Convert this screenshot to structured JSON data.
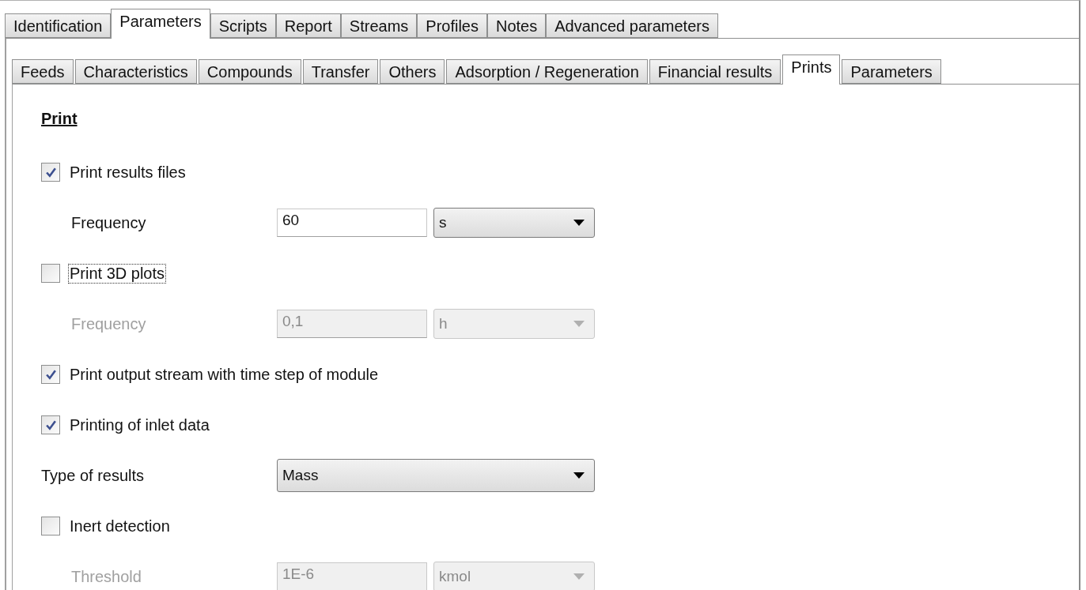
{
  "main_tabs": [
    {
      "label": "Identification",
      "selected": false
    },
    {
      "label": "Parameters",
      "selected": true
    },
    {
      "label": "Scripts",
      "selected": false
    },
    {
      "label": "Report",
      "selected": false
    },
    {
      "label": "Streams",
      "selected": false
    },
    {
      "label": "Profiles",
      "selected": false
    },
    {
      "label": "Notes",
      "selected": false
    },
    {
      "label": "Advanced parameters",
      "selected": false
    }
  ],
  "sub_tabs": [
    {
      "label": "Feeds",
      "selected": false
    },
    {
      "label": "Characteristics",
      "selected": false
    },
    {
      "label": "Compounds",
      "selected": false
    },
    {
      "label": "Transfer",
      "selected": false
    },
    {
      "label": "Others",
      "selected": false
    },
    {
      "label": "Adsorption / Regeneration",
      "selected": false
    },
    {
      "label": "Financial results",
      "selected": false
    },
    {
      "label": "Prints",
      "selected": true
    },
    {
      "label": "Parameters",
      "selected": false
    }
  ],
  "section_title": "Print",
  "rows": [
    {
      "kind": "checkbox",
      "label": "Print results files",
      "checked": true,
      "focused": false
    },
    {
      "kind": "field",
      "label": "Frequency",
      "value": "60",
      "unit": "s",
      "disabled": false
    },
    {
      "kind": "checkbox",
      "label": "Print 3D plots",
      "checked": false,
      "focused": true
    },
    {
      "kind": "field",
      "label": "Frequency",
      "value": "0,1",
      "unit": "h",
      "disabled": true
    },
    {
      "kind": "checkbox",
      "label": "Print output stream with time step of module",
      "checked": true,
      "focused": false
    },
    {
      "kind": "checkbox",
      "label": "Printing of inlet data",
      "checked": true,
      "focused": false
    },
    {
      "kind": "select",
      "label": "Type of results",
      "value": "Mass"
    },
    {
      "kind": "checkbox",
      "label": "Inert detection",
      "checked": false,
      "focused": false
    },
    {
      "kind": "field",
      "label": "Threshold",
      "value": "1E-6",
      "unit": "kmol",
      "disabled": true
    }
  ]
}
